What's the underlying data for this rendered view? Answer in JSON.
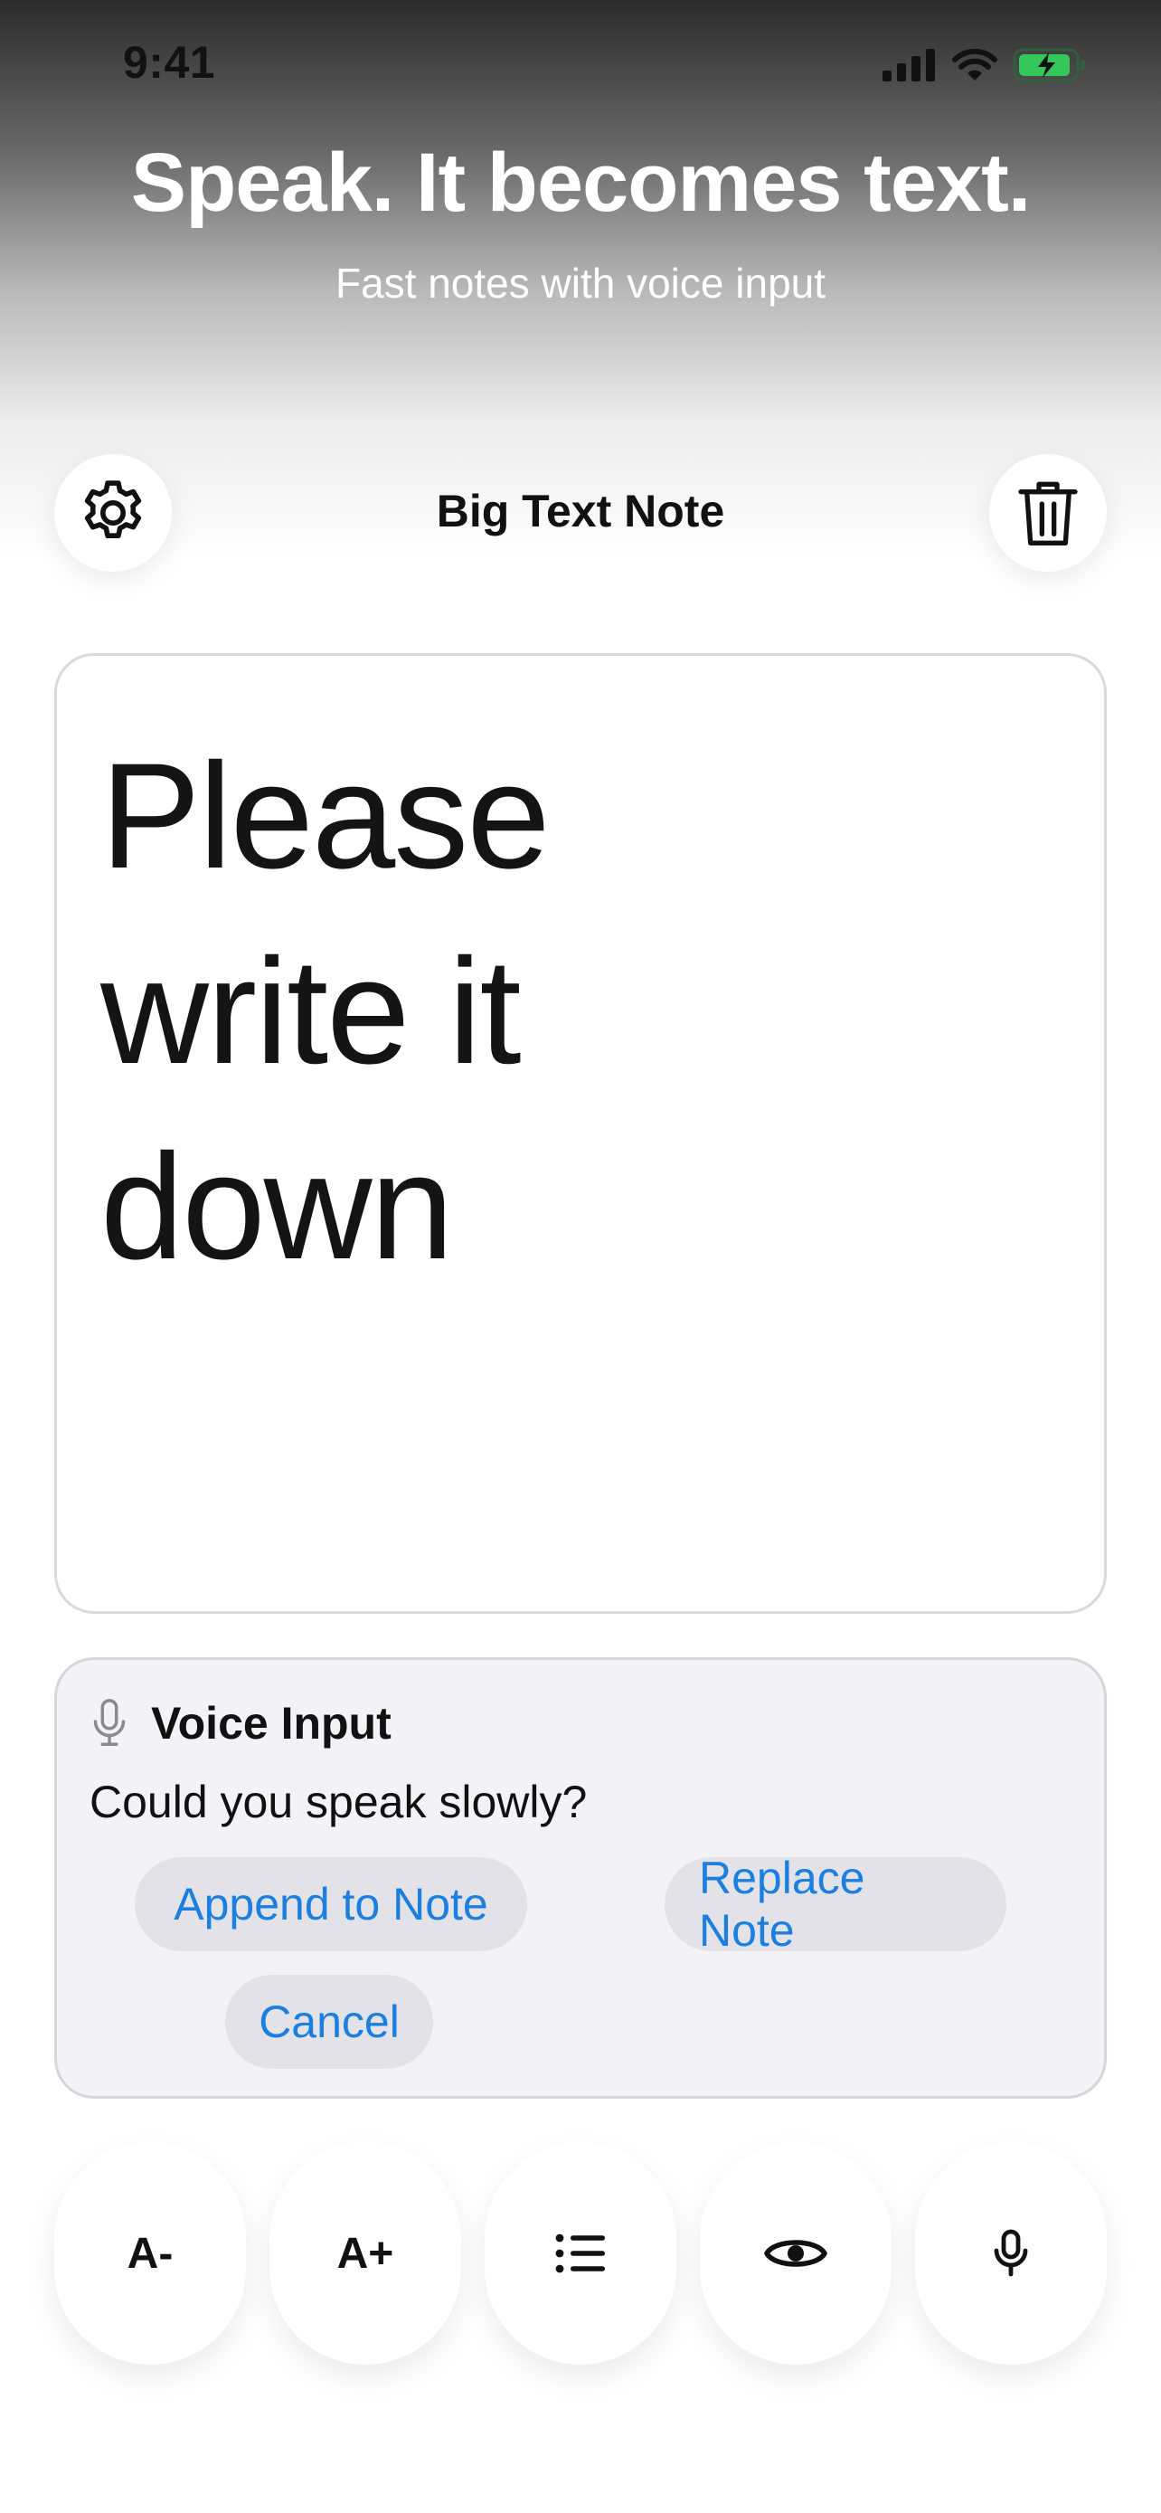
{
  "status_bar": {
    "time": "9:41"
  },
  "hero": {
    "title": "Speak. It becomes text.",
    "subtitle": "Fast notes with voice input"
  },
  "nav": {
    "title": "Big Text Note",
    "left_icon": "gear-icon",
    "right_icon": "trash-icon"
  },
  "note": {
    "text": "Please write it down"
  },
  "voice_panel": {
    "icon": "microphone-icon",
    "title": "Voice Input",
    "prompt": "Could you speak slowly?",
    "actions": {
      "append": "Append to Note",
      "replace": "Replace Note",
      "cancel": "Cancel"
    }
  },
  "toolbar": {
    "decrease_font": "A-",
    "increase_font": "A+",
    "list_icon": "list-icon",
    "preview_icon": "eye-icon",
    "mic_icon": "microphone-icon"
  },
  "colors": {
    "accent": "#1a7fe0",
    "panel_bg": "#f2f2f7",
    "pill_bg": "#e2e2e8",
    "battery_green": "#34c759"
  }
}
